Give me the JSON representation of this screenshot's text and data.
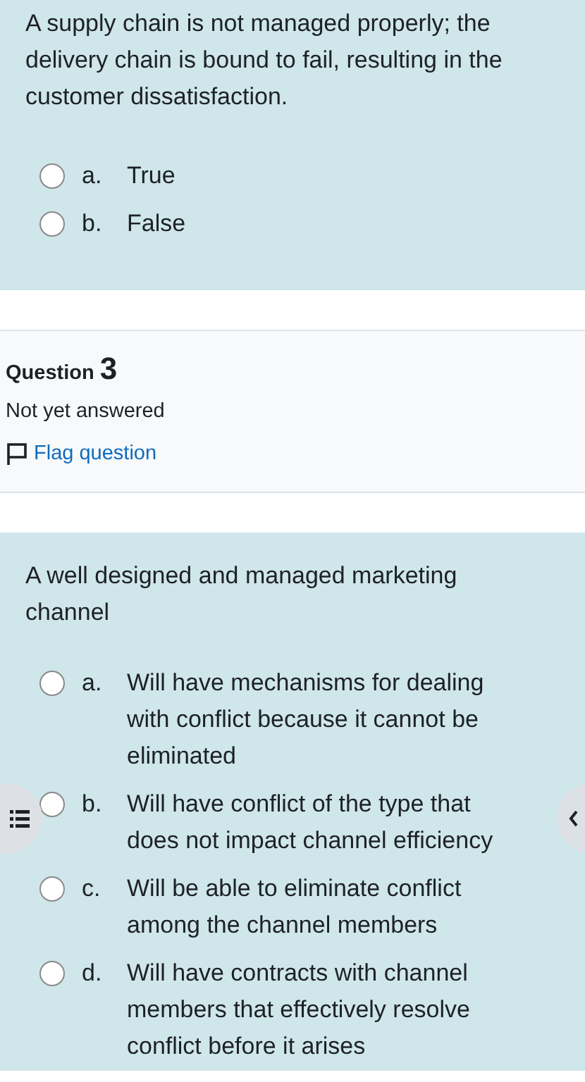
{
  "question_2": {
    "text": "A supply chain is not managed properly; the delivery chain is bound to fail, resulting in the customer dissatisfaction.",
    "options": [
      {
        "letter": "a.",
        "text": "True",
        "selected": false
      },
      {
        "letter": "b.",
        "text": "False",
        "selected": false
      }
    ]
  },
  "question_3_info": {
    "label": "Question",
    "number": "3",
    "status": "Not yet answered",
    "flag_link": "Flag question",
    "flagged": false
  },
  "question_3": {
    "text": "A well designed and managed marketing channel",
    "options": [
      {
        "letter": "a.",
        "text": "Will have mechanisms for dealing with conflict because it cannot be eliminated",
        "selected": false
      },
      {
        "letter": "b.",
        "text": "Will have conflict of the type that does not impact channel efficiency",
        "selected": false
      },
      {
        "letter": "c.",
        "text": "Will be able to eliminate conflict among the channel members",
        "selected": false
      },
      {
        "letter": "d.",
        "text": "Will have contracts with channel members that effectively resolve conflict before it arises",
        "selected": false
      }
    ]
  }
}
